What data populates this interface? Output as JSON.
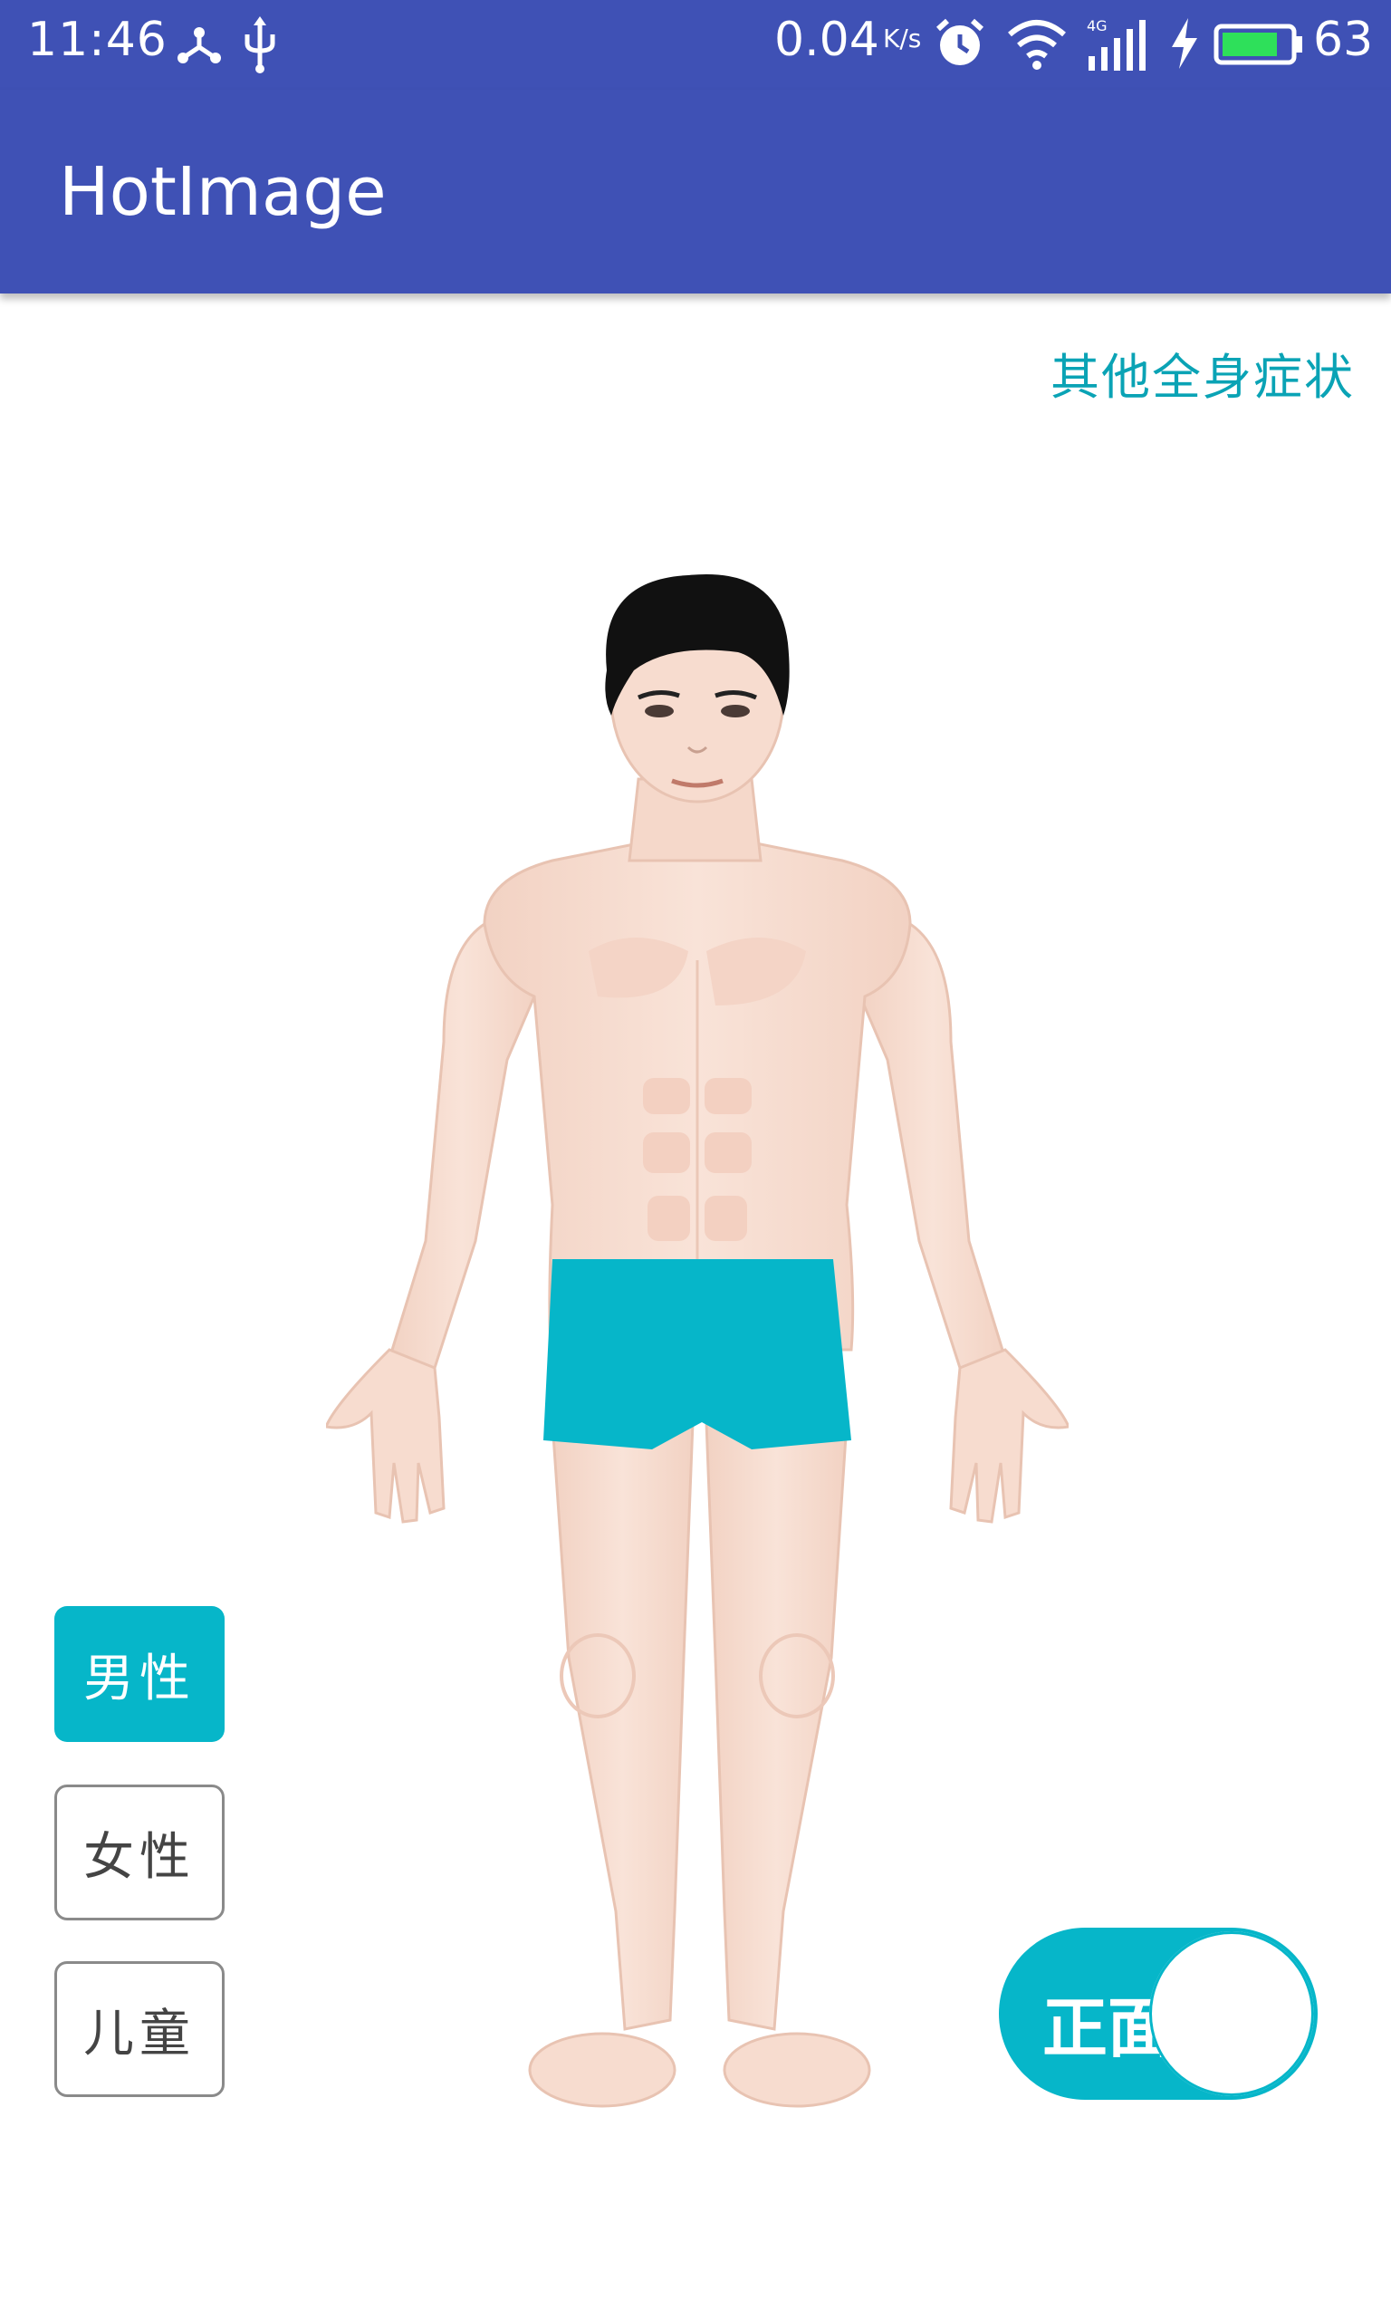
{
  "status_bar": {
    "time": "11:46",
    "speed": "0.04",
    "speed_unit": "K/s",
    "network_type": "4G",
    "battery_percent": "63",
    "icons": [
      "usb-tether-icon",
      "usb-icon",
      "alarm-icon",
      "wifi-icon",
      "signal-icon",
      "charging-icon",
      "battery-icon"
    ]
  },
  "app_bar": {
    "title": "HotImage"
  },
  "top_link": {
    "label": "其他全身症状"
  },
  "gender_buttons": [
    {
      "label": "男性",
      "selected": true
    },
    {
      "label": "女性",
      "selected": false
    },
    {
      "label": "儿童",
      "selected": false
    }
  ],
  "view_toggle": {
    "label": "正面"
  },
  "colors": {
    "primary": "#3f51b5",
    "accent": "#06b6c9",
    "link": "#0aa3b5",
    "skin": "#f7ddd0",
    "shorts": "#06b6c9",
    "hair": "#111111"
  }
}
